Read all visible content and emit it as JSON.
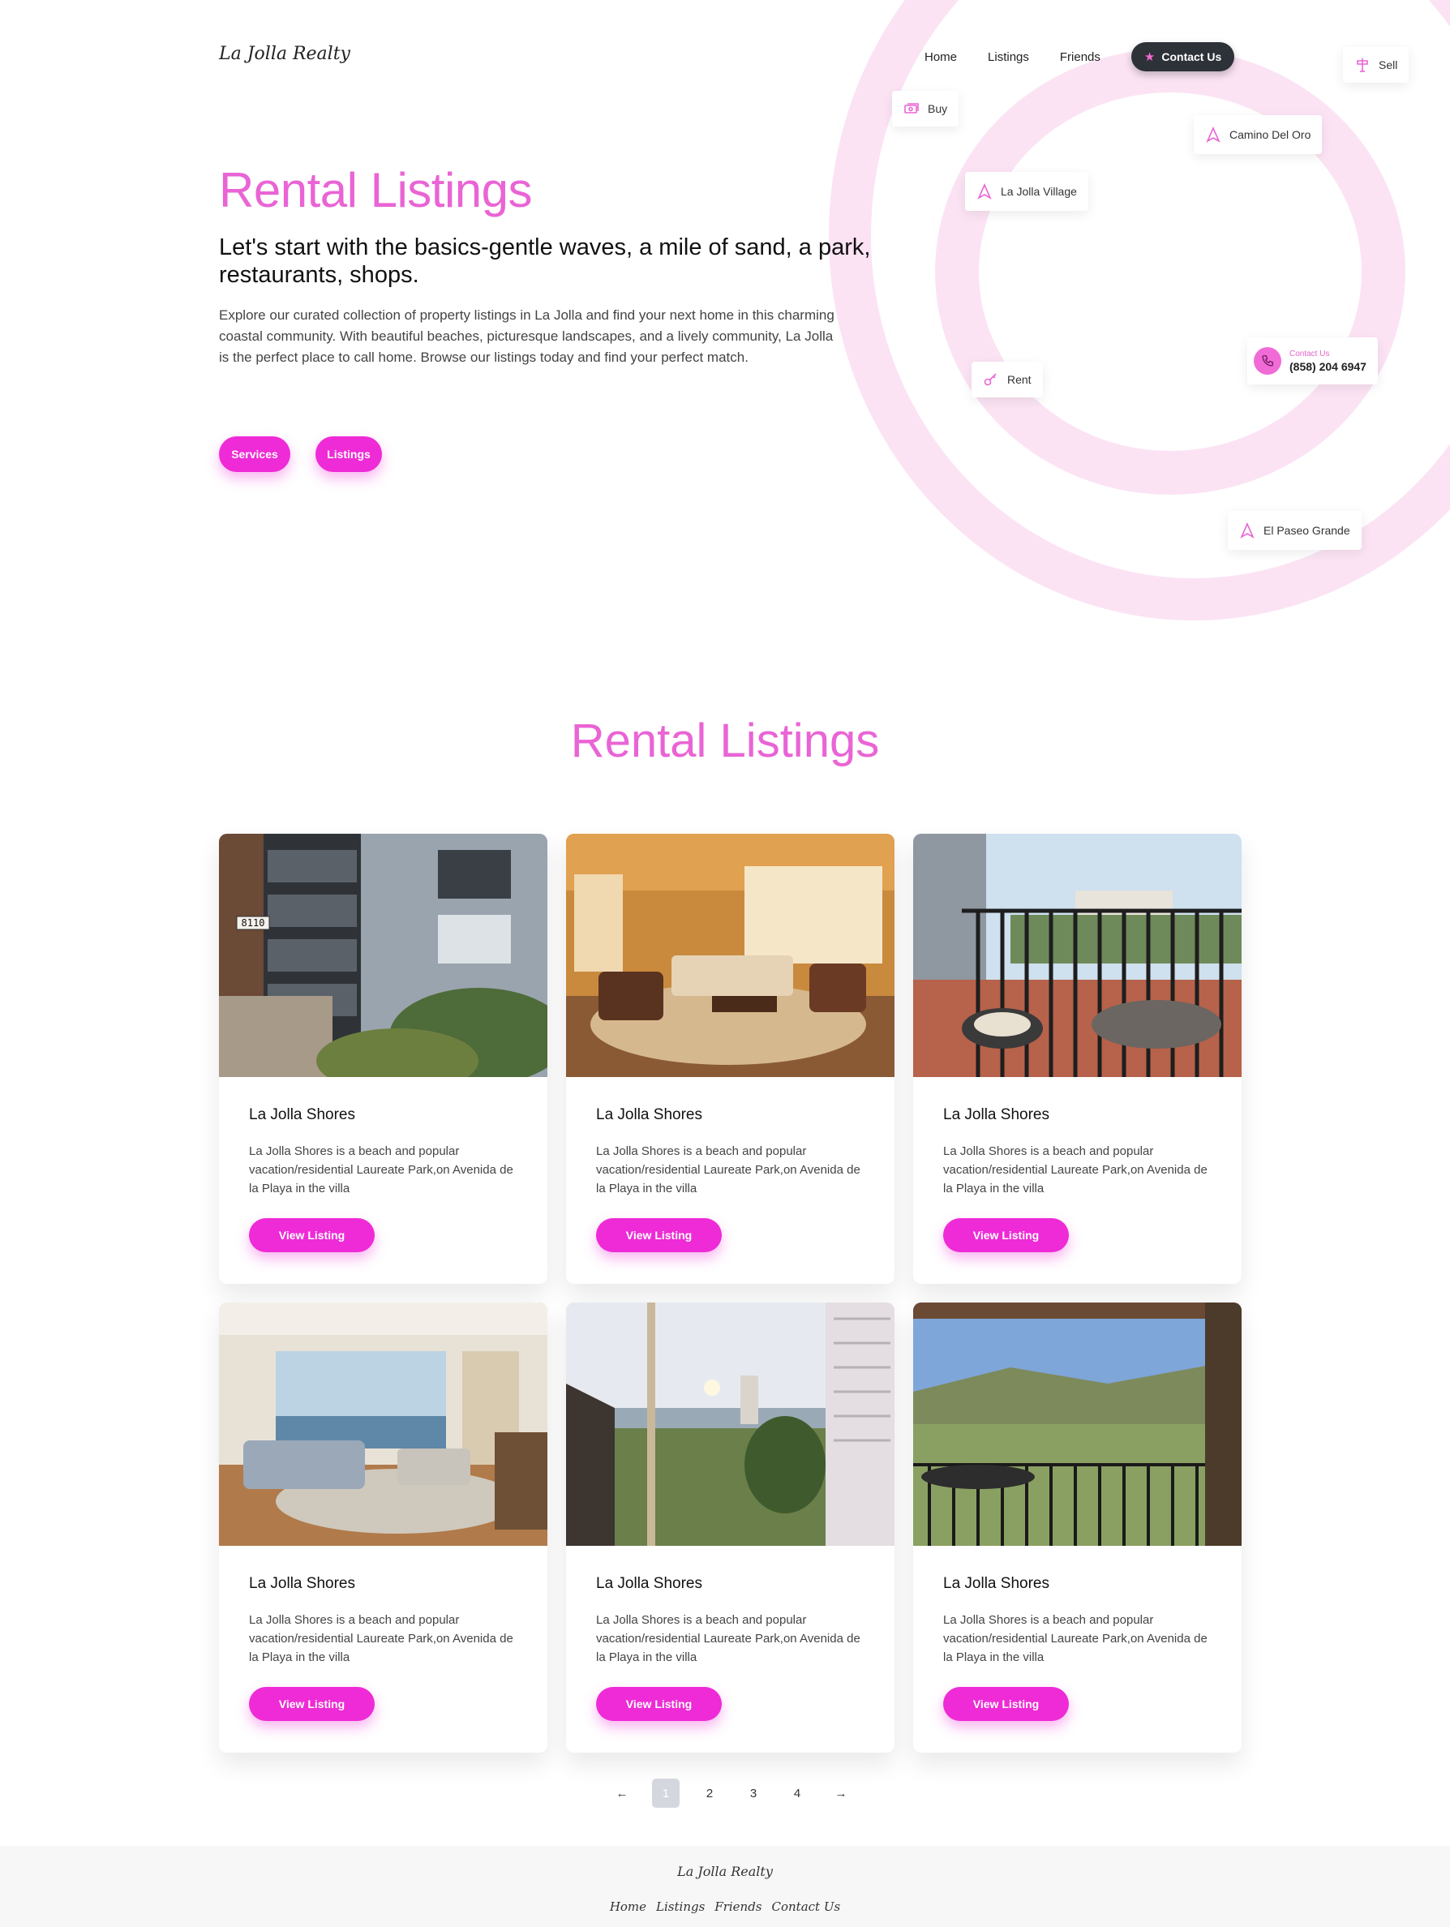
{
  "header": {
    "brand": "La Jolla Realty",
    "nav": [
      "Home",
      "Listings",
      "Friends"
    ],
    "contact_label": "Contact Us"
  },
  "chips": {
    "sell": "Sell",
    "buy": "Buy",
    "camino": "Camino Del Oro",
    "village": "La Jolla Village",
    "rent": "Rent",
    "paseo": "El Paseo Grande",
    "contact_label": "Contact Us",
    "phone": "(858) 204 6947"
  },
  "hero": {
    "title": "Rental Listings",
    "subtitle": "Let's start with the basics-gentle waves, a mile of sand, a park, restaurants, shops.",
    "description": "Explore our curated collection of property listings in La Jolla and find your next home in this charming coastal community. With beautiful beaches, picturesque landscapes, and a lively community, La Jolla is the perfect place to call home. Browse our listings today and find your perfect match.",
    "services_btn": "Services",
    "listings_btn": "Listings"
  },
  "section": {
    "title": "Rental Listings"
  },
  "listings": [
    {
      "title": "La Jolla Shores",
      "description": "La Jolla Shores is a beach and popular vacation/residential Laureate Park,on Avenida de la Playa in the villa",
      "button": "View Listing",
      "image_label": "8110"
    },
    {
      "title": "La Jolla Shores",
      "description": "La Jolla Shores is a beach and popular vacation/residential Laureate Park,on Avenida de la Playa in the villa",
      "button": "View Listing"
    },
    {
      "title": "La Jolla Shores",
      "description": "La Jolla Shores is a beach and popular vacation/residential Laureate Park,on Avenida de la Playa in the villa",
      "button": "View Listing"
    },
    {
      "title": "La Jolla Shores",
      "description": "La Jolla Shores is a beach and popular vacation/residential Laureate Park,on Avenida de la Playa in the villa",
      "button": "View Listing"
    },
    {
      "title": "La Jolla Shores",
      "description": "La Jolla Shores is a beach and popular vacation/residential Laureate Park,on Avenida de la Playa in the villa",
      "button": "View Listing"
    },
    {
      "title": "La Jolla Shores",
      "description": "La Jolla Shores is a beach and popular vacation/residential Laureate Park,on Avenida de la Playa in the villa",
      "button": "View Listing"
    }
  ],
  "pagination": {
    "prev": "←",
    "pages": [
      "1",
      "2",
      "3",
      "4"
    ],
    "next": "→",
    "current": "1"
  },
  "footer": {
    "brand": "La Jolla Realty",
    "links": [
      "Home",
      "Listings",
      "Friends",
      "Contact Us"
    ]
  },
  "colors": {
    "accent": "#e964d5",
    "button": "#ee2bd6",
    "dark": "#2d3138",
    "ring": "#fbe3f4"
  }
}
